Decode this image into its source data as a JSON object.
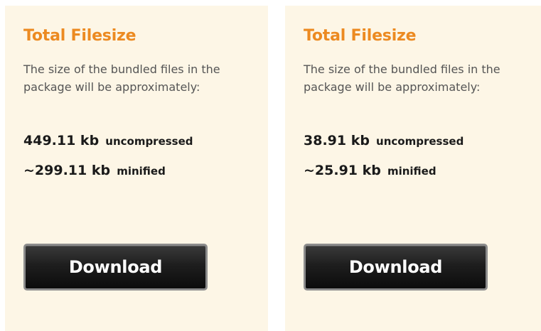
{
  "panels": [
    {
      "title": "Total Filesize",
      "description": "The size of the bundled files in the package will be approximately:",
      "uncompressed_value": "449.11 kb",
      "uncompressed_label": "uncompressed",
      "minified_value": "~299.11 kb",
      "minified_label": "minified",
      "download_label": "Download"
    },
    {
      "title": "Total Filesize",
      "description": "The size of the bundled files in the package will be approximately:",
      "uncompressed_value": "38.91 kb",
      "uncompressed_label": "uncompressed",
      "minified_value": "~25.91 kb",
      "minified_label": "minified",
      "download_label": "Download"
    }
  ],
  "colors": {
    "panel_background": "#fdf6e6",
    "title_orange": "#ec8a21",
    "button_dark": "#1e1e1e",
    "button_border": "#8c8c8c"
  }
}
